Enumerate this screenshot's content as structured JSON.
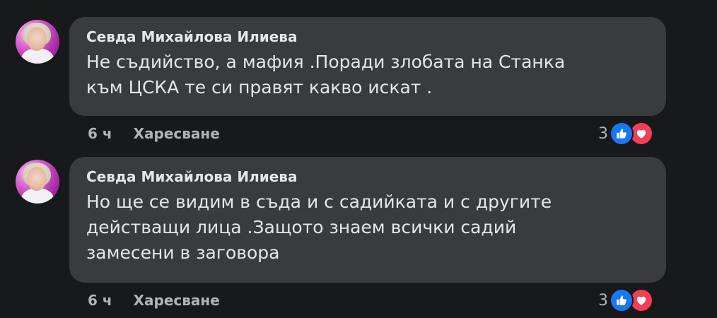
{
  "comments": [
    {
      "author": "Севда Михайлова Илиева",
      "lines": [
        "Не съдийство, а мафия .Поради злобата на Станка",
        "към ЦСКА те си правят какво искат ."
      ],
      "time": "6 ч",
      "like_label": "Харесване",
      "reaction_count": "3",
      "reactions": [
        "like-icon",
        "love-icon"
      ]
    },
    {
      "author": "Севда Михайлова Илиева",
      "lines": [
        "Но ще се видим в съда и с садийката и с другите",
        "действащи лица .Защото знаем всички садий",
        "замесени в заговора"
      ],
      "time": "6 ч",
      "like_label": "Харесване",
      "reaction_count": "3",
      "reactions": [
        "like-icon",
        "love-icon"
      ]
    }
  ],
  "colors": {
    "background": "#18191a",
    "bubble": "#3a3b3c",
    "text": "#e4e6eb",
    "secondary_text": "#b0b3b8",
    "like_blue": "#1877f2",
    "love_red": "#f33e58"
  }
}
